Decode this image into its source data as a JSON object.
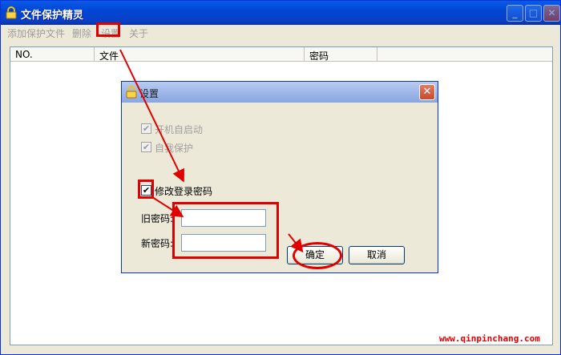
{
  "window": {
    "title": "文件保护精灵",
    "minimize": "_",
    "maximize": "□",
    "close": "✕"
  },
  "menu": {
    "items": [
      "添加保护文件",
      "删除",
      "设置",
      "关于"
    ]
  },
  "list": {
    "columns": [
      "NO.",
      "文件",
      "密码",
      ""
    ]
  },
  "dialog": {
    "title": "设置",
    "close": "✕",
    "options": [
      {
        "label": "开机自启动",
        "checked": true,
        "enabled": false
      },
      {
        "label": "自我保护",
        "checked": true,
        "enabled": false
      }
    ],
    "change_password": {
      "label": "修改登录密码",
      "checked": true
    },
    "old_password_label": "旧密码:",
    "new_password_label": "新密码:",
    "old_password_value": "",
    "new_password_value": "",
    "ok_label": "确定",
    "cancel_label": "取消"
  },
  "check_mark": "✔",
  "icons": {
    "app_icon": "lock-icon",
    "dialog_icon": "lock-icon"
  },
  "annotation_color": "#e00000",
  "watermark": "www.qinpinchang.com"
}
